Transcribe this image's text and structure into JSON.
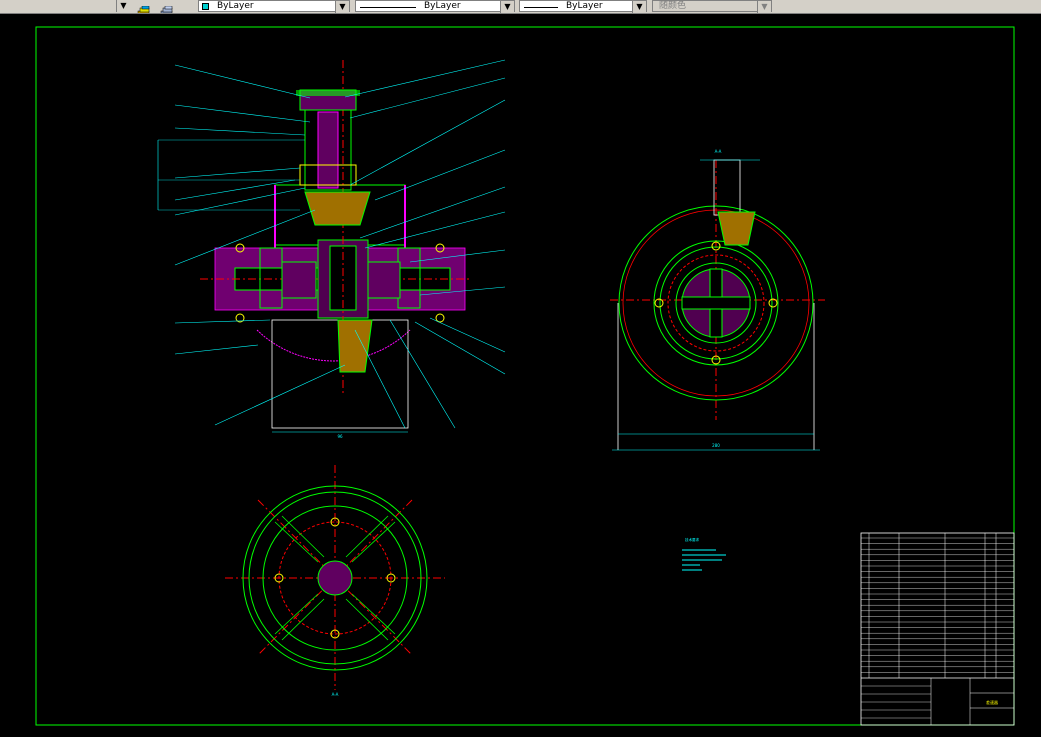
{
  "toolbar": {
    "linetype_value": "ByLayer",
    "lineweight_value": "ByLayer",
    "linestyle_value": "ByLayer",
    "color_value": "随颜色",
    "layer_icon": "layer-stack-icon",
    "dropdown_icon": "chevron-down-icon"
  },
  "drawing": {
    "section_label_top": "A-A",
    "section_label_bottom": "A-A",
    "tech_notes_title": "技术要求",
    "dim_width_right": "280",
    "dim_width_main": "96"
  },
  "title_block": {
    "drawing_title": "差速器"
  },
  "colors": {
    "background": "#000000",
    "frame": "#00ff00",
    "dimension": "#00ffff",
    "centerline": "#ff0000",
    "hatch": "#ff00ff",
    "outline": "#00ff00",
    "parts": "#ffff00",
    "leader": "#00ffff",
    "toolbar": "#d4d0c8"
  }
}
